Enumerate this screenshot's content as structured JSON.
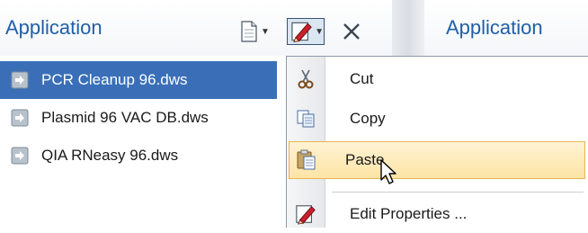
{
  "header": {
    "left_title": "Application",
    "right_title": "Application"
  },
  "toolbar": {
    "new_icon": "new-document-icon",
    "edit_icon": "edit-properties-icon",
    "close_icon": "close-icon"
  },
  "file_list": [
    {
      "label": "PCR Cleanup 96.dws",
      "selected": true
    },
    {
      "label": "Plasmid 96 VAC DB.dws",
      "selected": false
    },
    {
      "label": "QIA RNeasy 96.dws",
      "selected": false
    }
  ],
  "context_menu": {
    "items": [
      {
        "label": "Cut",
        "icon": "cut-icon"
      },
      {
        "label": "Copy",
        "icon": "copy-icon"
      },
      {
        "label": "Paste",
        "icon": "paste-icon",
        "highlighted": true
      },
      {
        "label": "Edit Properties ...",
        "icon": "edit-properties-icon"
      }
    ]
  },
  "colors": {
    "selection": "#3a6fb8",
    "title": "#1f5fa8",
    "menu_highlight": "#fde4a5"
  }
}
